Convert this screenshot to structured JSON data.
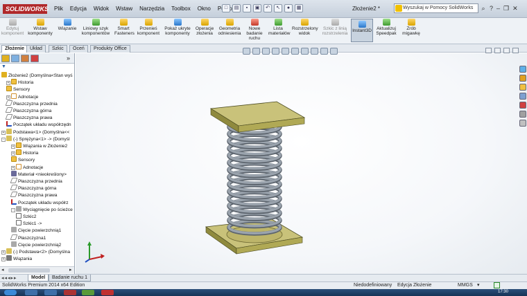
{
  "app": {
    "logo": "SOLIDWORKS",
    "menu": [
      "Plik",
      "Edycja",
      "Widok",
      "Wstaw",
      "Narzędzia",
      "Toolbox",
      "Okno",
      "Pomoc"
    ],
    "document_title": "Złożenie2 *",
    "search_placeholder": "Wyszukaj w Pomocy SolidWorks"
  },
  "commands": [
    {
      "label": "Edytuj komponent",
      "dim": true
    },
    {
      "label": "Wstaw komponenty",
      "dim": false
    },
    {
      "label": "Wiązanie",
      "dim": false
    },
    {
      "label": "Liniowy szyk komponentów",
      "dim": false
    },
    {
      "label": "Smart Fasteners",
      "dim": false
    },
    {
      "label": "Przenieś komponent",
      "dim": false
    },
    {
      "label": "Pokaż ukryte komponenty",
      "dim": false
    },
    {
      "label": "Operacje złożenia",
      "dim": false
    },
    {
      "label": "Geometria odniesienia",
      "dim": false
    },
    {
      "label": "Nowe badanie ruchu",
      "dim": false
    },
    {
      "label": "Lista materiałów",
      "dim": false
    },
    {
      "label": "Rozstrzelony widok",
      "dim": false
    },
    {
      "label": "Szkic z linią rozstrzelenia",
      "dim": true
    },
    {
      "label": "Instant3D",
      "dim": false,
      "active": true
    },
    {
      "label": "Aktualizuj Speedpak",
      "dim": false
    },
    {
      "label": "Zrób migawkę",
      "dim": false
    }
  ],
  "tabs": [
    "Złożenie",
    "Układ",
    "Szkic",
    "Oceń",
    "Produkty Office"
  ],
  "tree": [
    {
      "label": "Złożenie2 (Domyślna<Stan wyś",
      "indent": 0,
      "icon": "asm"
    },
    {
      "label": "Historia",
      "indent": 1,
      "icon": "folder",
      "exp": "+"
    },
    {
      "label": "Sensory",
      "indent": 1,
      "icon": "folder"
    },
    {
      "label": "Adnotacje",
      "indent": 1,
      "icon": "annot",
      "exp": "+"
    },
    {
      "label": "Płaszczyzna przednia",
      "indent": 1,
      "icon": "plane"
    },
    {
      "label": "Płaszczyzna górna",
      "indent": 1,
      "icon": "plane"
    },
    {
      "label": "Płaszczyzna prawa",
      "indent": 1,
      "icon": "plane"
    },
    {
      "label": "Początek układu współrzędn",
      "indent": 1,
      "icon": "origin"
    },
    {
      "label": "Podstawa<1> (Domyślna<<",
      "indent": 0,
      "icon": "part",
      "exp": "+"
    },
    {
      "label": "(-) Sprężyna<1> -> (Domyśl",
      "indent": 0,
      "icon": "part",
      "exp": "-"
    },
    {
      "label": "Wiązania w Złożenie2",
      "indent": 2,
      "icon": "folder",
      "exp": "+"
    },
    {
      "label": "Historia",
      "indent": 2,
      "icon": "folder",
      "exp": "+"
    },
    {
      "label": "Sensory",
      "indent": 2,
      "icon": "folder"
    },
    {
      "label": "Adnotacje",
      "indent": 2,
      "icon": "annot",
      "exp": "+"
    },
    {
      "label": "Materiał <nieokreślony>",
      "indent": 2,
      "icon": "mat"
    },
    {
      "label": "Płaszczyzna przednia",
      "indent": 2,
      "icon": "plane"
    },
    {
      "label": "Płaszczyzna górna",
      "indent": 2,
      "icon": "plane"
    },
    {
      "label": "Płaszczyzna prawa",
      "indent": 2,
      "icon": "plane"
    },
    {
      "label": "Początek układu współrz",
      "indent": 2,
      "icon": "origin"
    },
    {
      "label": "Wyciągnięcie po ścieżce",
      "indent": 2,
      "icon": "feat",
      "exp": "-"
    },
    {
      "label": "Szkic2",
      "indent": 3,
      "icon": "sketch"
    },
    {
      "label": "Szkic1 ->",
      "indent": 3,
      "icon": "sketch"
    },
    {
      "label": "Cięcie powierzchnią1",
      "indent": 2,
      "icon": "feat"
    },
    {
      "label": "Płaszczyzna1",
      "indent": 2,
      "icon": "plane"
    },
    {
      "label": "Cięcie powierzchnią2",
      "indent": 2,
      "icon": "feat"
    },
    {
      "label": "(-) Podstawa<2> (Domyślna",
      "indent": 0,
      "icon": "part",
      "exp": "+"
    },
    {
      "label": "Wiązania",
      "indent": 0,
      "icon": "mate",
      "exp": "+"
    }
  ],
  "bottom_tabs": [
    "Model",
    "Badanie ruchu 1"
  ],
  "status": {
    "edition": "SolidWorks Premium 2014 x64 Edition",
    "state": "Niedodefiniowany",
    "mode": "Edycja Złożenie",
    "units": "MMGS"
  },
  "taskbar_clock": "17:30",
  "colors": {
    "plate_top": "#c9c27a",
    "plate_side": "#8f8a3e",
    "spring": "#9aa3ad",
    "accent": "#b0282a"
  }
}
